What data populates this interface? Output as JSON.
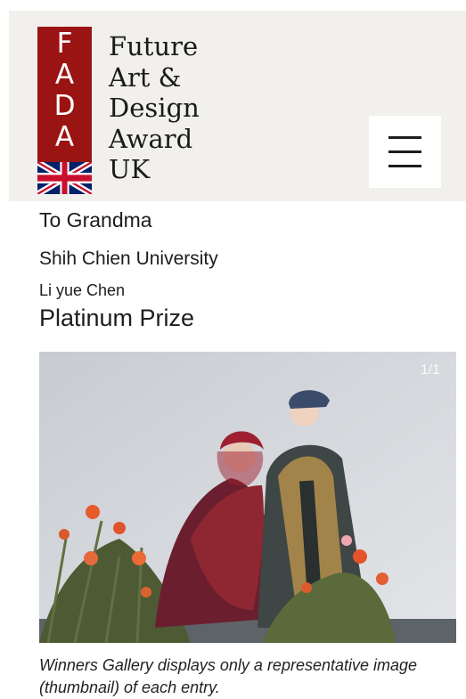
{
  "brand": {
    "mark_letters": [
      "F",
      "A",
      "D",
      "A"
    ],
    "name_lines": [
      "Future",
      "Art &",
      "Design",
      "Award",
      "UK"
    ],
    "mark_color": "#9b1414",
    "flag_icon": "union-jack-flag-icon"
  },
  "header": {
    "menu_icon": "hamburger-menu-icon"
  },
  "entry": {
    "title": "To Grandma",
    "university": "Shih Chien University",
    "designer": "Li yue Chen",
    "prize": "Platinum Prize"
  },
  "gallery": {
    "counter": "1/1"
  },
  "disclaimer": "Winners Gallery displays only a representative image (thumbnail) of each entry."
}
